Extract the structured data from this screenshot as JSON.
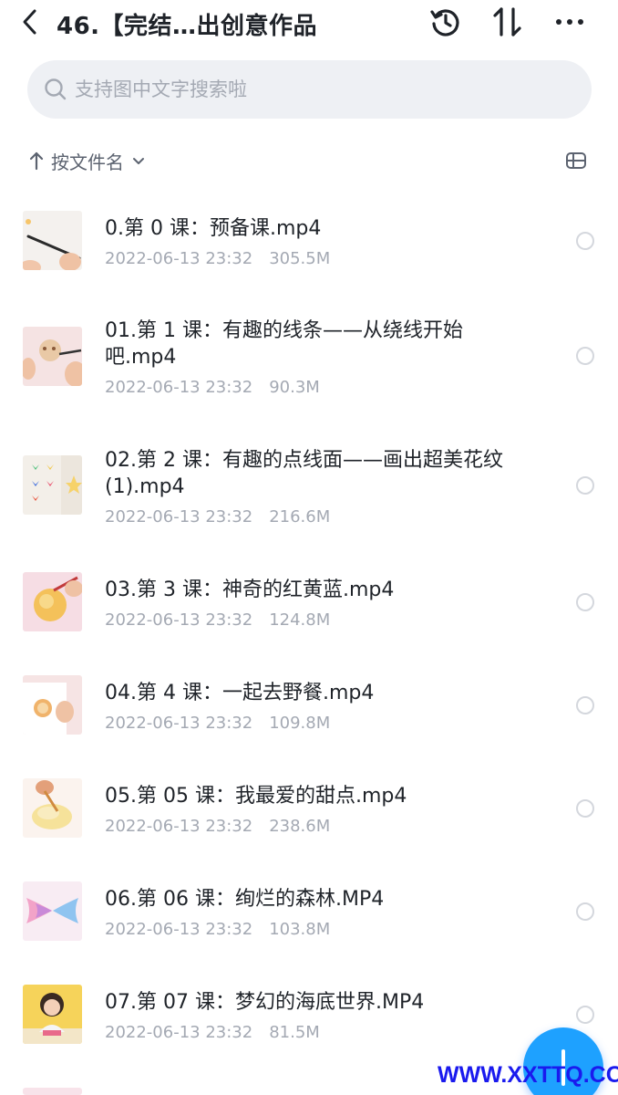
{
  "header": {
    "title": "46.【完结…出创意作品"
  },
  "search": {
    "placeholder": "支持图中文字搜索啦"
  },
  "sort": {
    "label": "按文件名"
  },
  "files": [
    {
      "name": "0.第 0 课：预备课.mp4",
      "date": "2022-06-13 23:32",
      "size": "305.5M"
    },
    {
      "name": "01.第 1 课：有趣的线条——从绕线开始吧.mp4",
      "date": "2022-06-13 23:32",
      "size": "90.3M"
    },
    {
      "name": "02.第 2 课：有趣的点线面——画出超美花纹 (1).mp4",
      "date": "2022-06-13 23:32",
      "size": "216.6M"
    },
    {
      "name": "03.第 3 课：神奇的红黄蓝.mp4",
      "date": "2022-06-13 23:32",
      "size": "124.8M"
    },
    {
      "name": "04.第 4 课：一起去野餐.mp4",
      "date": "2022-06-13 23:32",
      "size": "109.8M"
    },
    {
      "name": "05.第 05 课：我最爱的甜点.mp4",
      "date": "2022-06-13 23:32",
      "size": "238.6M"
    },
    {
      "name": "06.第 06 课：绚烂的森林.MP4",
      "date": "2022-06-13 23:32",
      "size": "103.8M"
    },
    {
      "name": "07.第 07 课：梦幻的海底世界.MP4",
      "date": "2022-06-13 23:32",
      "size": "81.5M"
    }
  ],
  "watermark": "WWW.XXTTQ.COM",
  "colors": {
    "accent": "#1ea1ff",
    "watermark": "#1a1aee",
    "secondary_text": "#a4a9b3"
  }
}
